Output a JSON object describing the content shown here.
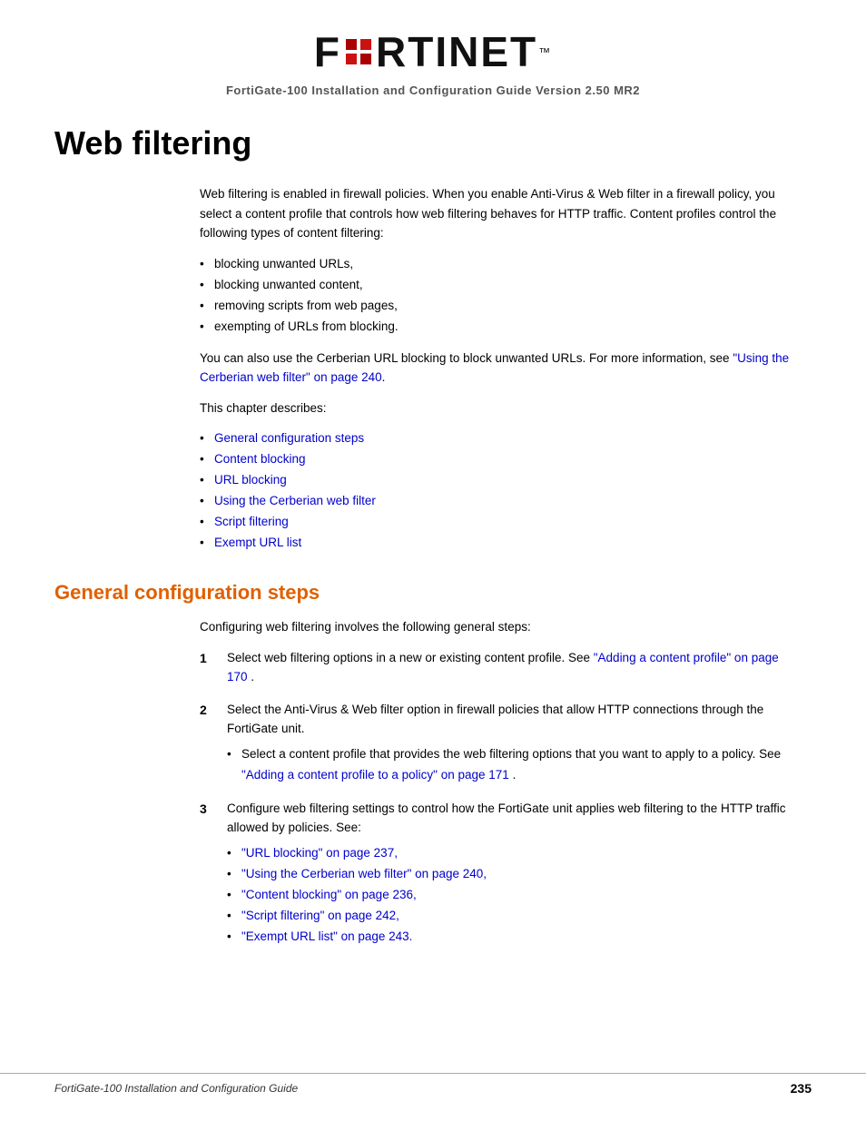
{
  "header": {
    "logo_alt": "Fortinet Logo",
    "subtitle": "FortiGate-100 Installation and Configuration Guide Version 2.50 MR2"
  },
  "page": {
    "title": "Web filtering",
    "intro_para1": "Web filtering is enabled in firewall policies. When you enable Anti-Virus & Web filter in a firewall policy, you select a content profile that controls how web filtering behaves for HTTP traffic. Content profiles control the following types of content filtering:",
    "bullet_items": [
      "blocking unwanted URLs,",
      "blocking unwanted content,",
      "removing scripts from web pages,",
      "exempting of URLs from blocking."
    ],
    "cerberian_para": "You can also use the Cerberian URL blocking to block unwanted URLs. For more information, see",
    "cerberian_link": "\"Using the Cerberian web filter\" on page 240",
    "chapter_describes": "This chapter describes:",
    "chapter_links": [
      {
        "text": "General configuration steps",
        "href": "#"
      },
      {
        "text": "Content blocking",
        "href": "#"
      },
      {
        "text": "URL blocking",
        "href": "#"
      },
      {
        "text": "Using the Cerberian web filter",
        "href": "#"
      },
      {
        "text": "Script filtering",
        "href": "#"
      },
      {
        "text": "Exempt URL list",
        "href": "#"
      }
    ]
  },
  "section": {
    "title": "General configuration steps",
    "intro": "Configuring web filtering involves the following general steps:",
    "steps": [
      {
        "number": "1",
        "text_before": "Select web filtering options in a new or existing content profile. See",
        "link_text": "\"Adding a content profile\" on page 170",
        "text_after": "."
      },
      {
        "number": "2",
        "text_main": "Select the Anti-Virus & Web filter option in firewall policies that allow HTTP connections through the FortiGate unit.",
        "sub_bullets": [
          {
            "text_before": "Select a content profile that provides the web filtering options that you want to apply to a policy. See",
            "link_text": "\"Adding a content profile to a policy\" on page 171",
            "text_after": "."
          }
        ]
      },
      {
        "number": "3",
        "text_main": "Configure web filtering settings to control how the FortiGate unit applies web filtering to the HTTP traffic allowed by policies. See:",
        "sub_bullets": [
          {
            "text": "\"URL blocking\" on page 237,",
            "link": true
          },
          {
            "text": "\"Using the Cerberian web filter\" on page 240,",
            "link": true
          },
          {
            "text": "\"Content blocking\" on page 236,",
            "link": true
          },
          {
            "text": "\"Script filtering\" on page 242,",
            "link": true
          },
          {
            "text": "\"Exempt URL list\" on page 243.",
            "link": true
          }
        ]
      }
    ]
  },
  "footer": {
    "left_text": "FortiGate-100 Installation and Configuration Guide",
    "page_number": "235"
  }
}
